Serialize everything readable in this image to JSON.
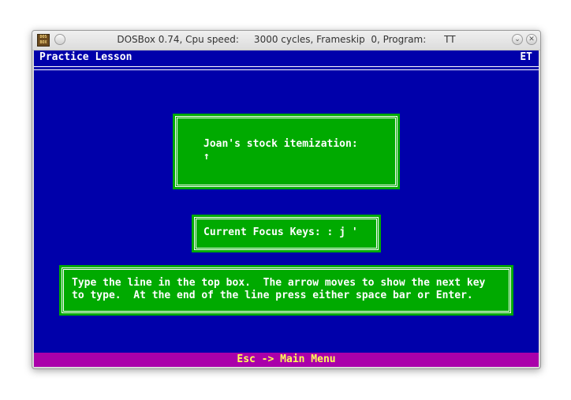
{
  "window": {
    "title": "DOSBox 0.74, Cpu speed:     3000 cycles, Frameskip  0, Program:      TT",
    "icon_label": "DOS BOX",
    "icons": [
      "dosbox-app-icon",
      "circle-icon",
      "chevron-down-icon",
      "close-icon"
    ]
  },
  "header": {
    "title": "Practice Lesson",
    "right_label": "ET"
  },
  "lesson_box": {
    "line1": "Joan's stock itemization:",
    "line2": "↑"
  },
  "focus_box": {
    "text": "Current Focus Keys: : j '"
  },
  "instructions_box": {
    "line1": "Type the line in the top box.  The arrow moves to show the next key",
    "line2": "to type.  At the end of the line press either space bar or Enter."
  },
  "statusbar": {
    "text": "Esc -> Main Menu"
  },
  "colors": {
    "background": "#0000aa",
    "box": "#00aa00",
    "statusbar": "#aa00aa",
    "statusbar_text": "#ffff55"
  }
}
